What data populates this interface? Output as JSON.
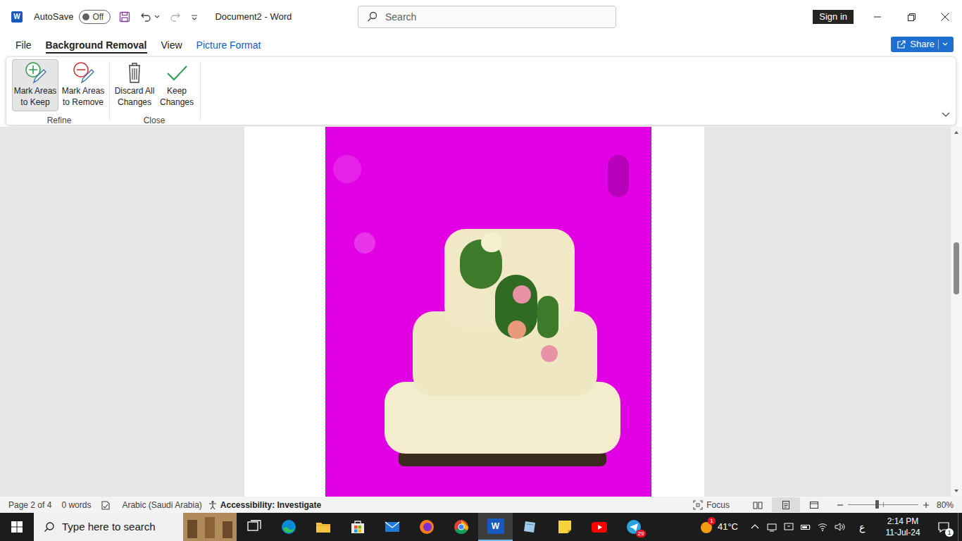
{
  "window": {
    "title": "Document2 - Word",
    "logo": "W"
  },
  "quick_access": {
    "autosave": {
      "label": "AutoSave",
      "on": false,
      "state": "Off"
    }
  },
  "search": {
    "placeholder": "Search"
  },
  "account": {
    "sign_in": "Sign in"
  },
  "tabs": [
    {
      "label": "File",
      "selected": false,
      "contextual": false
    },
    {
      "label": "Background Removal",
      "selected": true,
      "contextual": false
    },
    {
      "label": "View",
      "selected": false,
      "contextual": false
    },
    {
      "label": "Picture Format",
      "selected": false,
      "contextual": true
    }
  ],
  "share": {
    "label": "Share"
  },
  "ribbon": {
    "groups": [
      {
        "label": "Refine",
        "buttons": [
          {
            "lines": [
              "Mark Areas",
              "to Keep"
            ],
            "kind": "keep-mark",
            "selected": true
          },
          {
            "lines": [
              "Mark Areas",
              "to Remove"
            ],
            "kind": "remove-mark",
            "selected": false
          }
        ]
      },
      {
        "label": "Close",
        "buttons": [
          {
            "lines": [
              "Discard All",
              "Changes"
            ],
            "kind": "discard",
            "selected": false
          },
          {
            "lines": [
              "Keep",
              "Changes"
            ],
            "kind": "keep",
            "selected": false
          }
        ]
      }
    ]
  },
  "document": {
    "scroll_level": 0.3
  },
  "status_bar": {
    "page": "Page 2 of 4",
    "words": "0 words",
    "language": "Arabic (Saudi Arabia)",
    "accessibility": "Accessibility: Investigate",
    "focus": "Focus",
    "views": [
      {
        "kind": "read",
        "selected": false
      },
      {
        "kind": "print",
        "selected": true
      },
      {
        "kind": "web",
        "selected": false
      }
    ],
    "zoom": {
      "level": 0.39,
      "reading": "80%"
    }
  },
  "taskbar": {
    "search_placeholder": "Type here to search",
    "apps": [
      {
        "kind": "task-view",
        "active": false
      },
      {
        "kind": "edge",
        "active": false
      },
      {
        "kind": "explorer",
        "active": false
      },
      {
        "kind": "store",
        "active": false
      },
      {
        "kind": "mail",
        "active": false
      },
      {
        "kind": "firefox",
        "active": false
      },
      {
        "kind": "chrome",
        "active": false
      },
      {
        "kind": "word",
        "active": true
      },
      {
        "kind": "app",
        "active": false
      },
      {
        "kind": "sticky-notes",
        "active": false
      },
      {
        "kind": "youtube",
        "active": false
      },
      {
        "kind": "telegram",
        "active": false,
        "badge": "29"
      }
    ],
    "weather": {
      "temp": "41°C",
      "badge": "1"
    },
    "tray": [
      {
        "kind": "chevron"
      },
      {
        "kind": "device"
      },
      {
        "kind": "display"
      },
      {
        "kind": "battery"
      },
      {
        "kind": "wifi"
      },
      {
        "kind": "volume"
      }
    ],
    "ime": "ع",
    "time": "2:14 PM",
    "date": "11-Jul-24",
    "notifications": "1"
  }
}
